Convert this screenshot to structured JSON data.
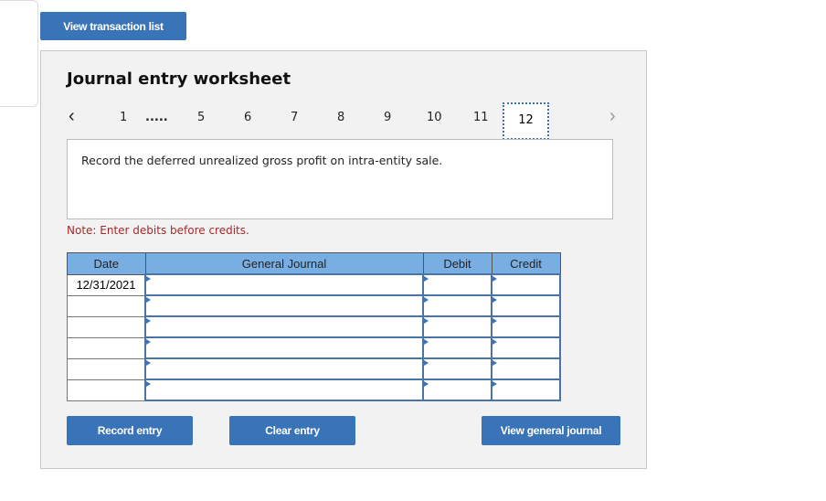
{
  "header": {
    "view_transaction_label": "View transaction list"
  },
  "worksheet": {
    "title": "Journal entry worksheet",
    "nav": {
      "items": [
        "1",
        ".....",
        "5",
        "6",
        "7",
        "8",
        "9",
        "10",
        "11"
      ],
      "active": "12",
      "prev_icon": "chevron-left",
      "next_icon": "chevron-right"
    },
    "description": "Record the deferred unrealized gross profit on intra-entity sale.",
    "note": "Note: Enter debits before credits.",
    "table": {
      "headers": [
        "Date",
        "General Journal",
        "Debit",
        "Credit"
      ],
      "rows": [
        {
          "date": "12/31/2021",
          "account": "",
          "debit": "",
          "credit": ""
        },
        {
          "date": "",
          "account": "",
          "debit": "",
          "credit": ""
        },
        {
          "date": "",
          "account": "",
          "debit": "",
          "credit": ""
        },
        {
          "date": "",
          "account": "",
          "debit": "",
          "credit": ""
        },
        {
          "date": "",
          "account": "",
          "debit": "",
          "credit": ""
        },
        {
          "date": "",
          "account": "",
          "debit": "",
          "credit": ""
        }
      ]
    },
    "buttons": {
      "record": "Record entry",
      "clear": "Clear entry",
      "view_journal": "View general journal"
    }
  }
}
